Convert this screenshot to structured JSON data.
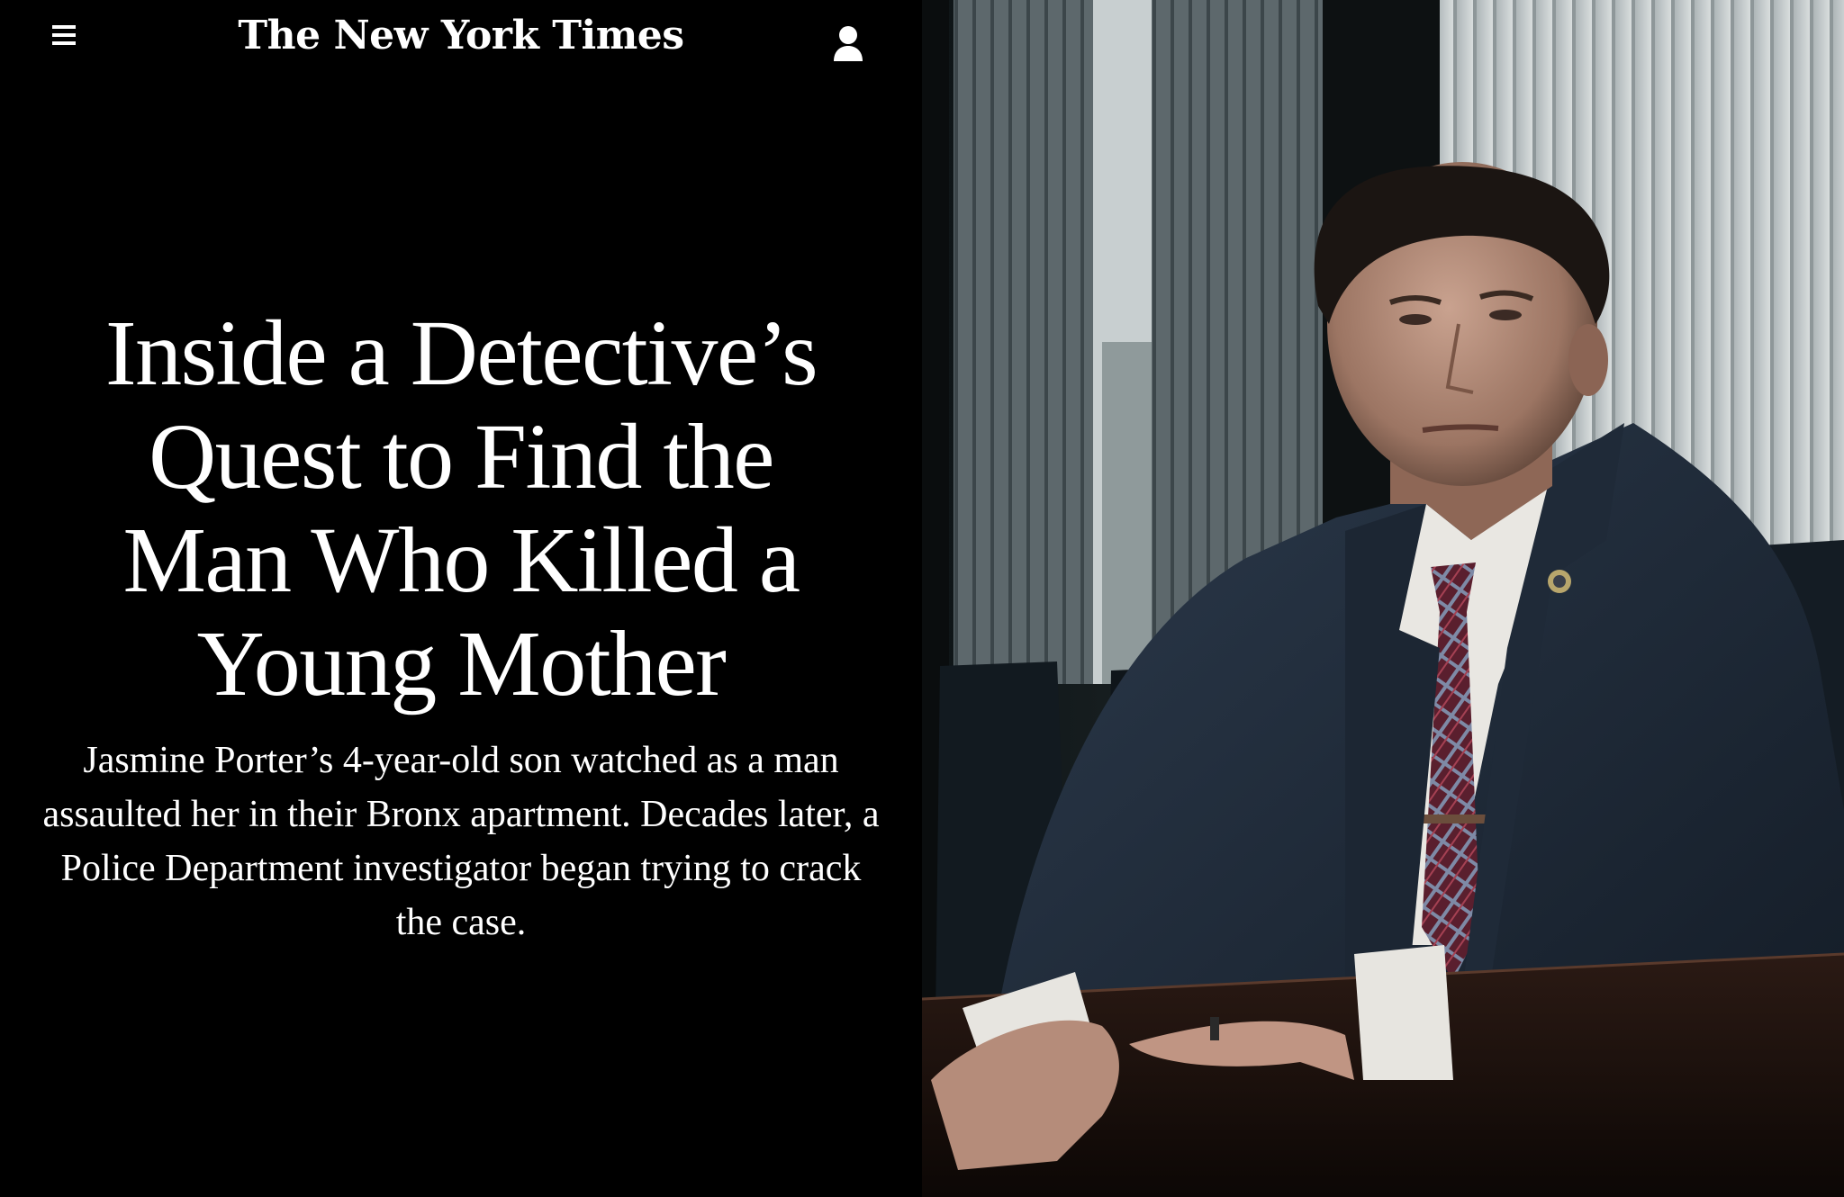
{
  "header": {
    "menu_icon": "hamburger-menu-icon",
    "logo_text": "The New York Times",
    "account_icon": "user-account-icon"
  },
  "article": {
    "headline": "Inside a Detective’s Quest to Find the Man Who Killed a Young Mother",
    "summary": "Jasmine Porter’s 4-year-old son watched as a man assaulted her in their Bronx apartment. Decades later, a Police Department investigator began trying to crack the case."
  },
  "colors": {
    "background": "#000000",
    "text": "#ffffff"
  }
}
